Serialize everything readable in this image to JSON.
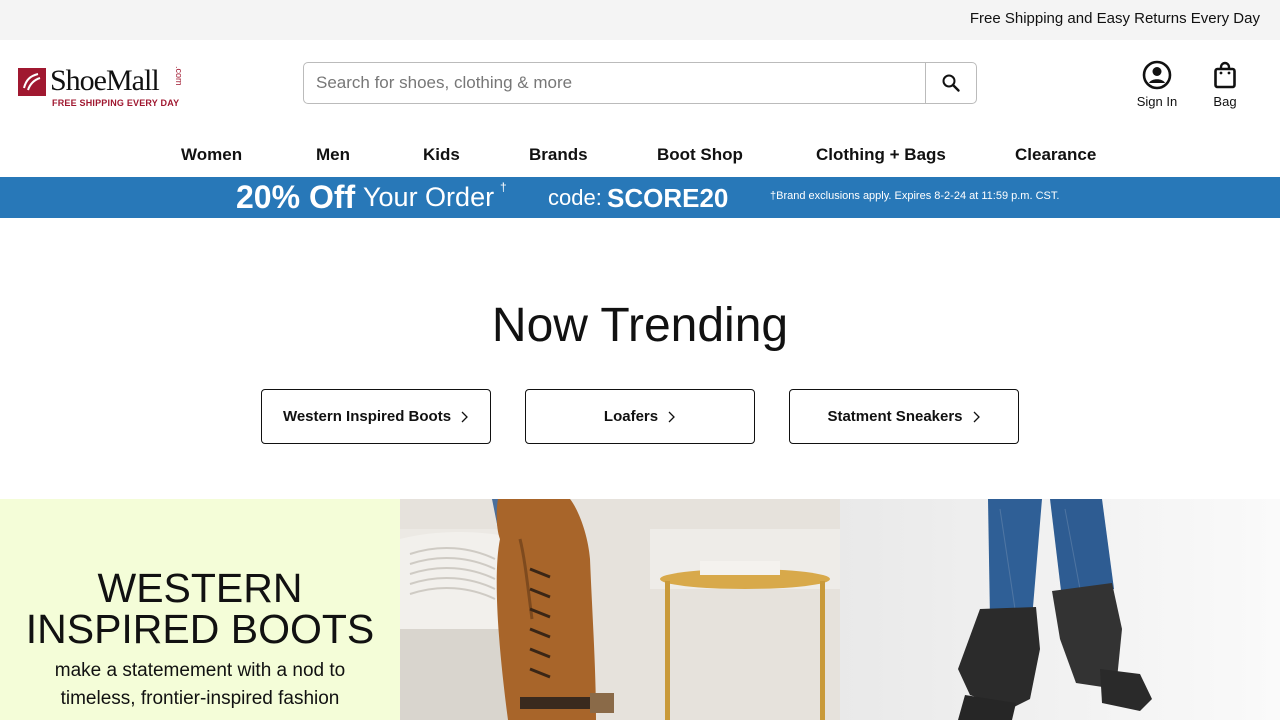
{
  "topbar": {
    "message": "Free Shipping and Easy Returns Every Day"
  },
  "logo": {
    "brand": "ShoeMall",
    "tld": ".com",
    "tagline": "FREE SHIPPING EVERY DAY"
  },
  "search": {
    "placeholder": "Search for shoes, clothing & more",
    "value": ""
  },
  "account": {
    "sign_in": "Sign In",
    "bag": "Bag"
  },
  "nav": {
    "items": [
      {
        "label": "Women"
      },
      {
        "label": "Men"
      },
      {
        "label": "Kids"
      },
      {
        "label": "Brands"
      },
      {
        "label": "Boot Shop"
      },
      {
        "label": "Clothing + Bags"
      },
      {
        "label": "Clearance"
      }
    ]
  },
  "promo": {
    "headline": "20% Off",
    "subhead": "Your Order",
    "dagger": "†",
    "code_label": "code:",
    "code": "SCORE20",
    "disclaimer": "†Brand exclusions apply. Expires 8-2-24 at 11:59 p.m. CST."
  },
  "trending": {
    "title": "Now Trending",
    "pills": [
      {
        "label": "Western Inspired Boots"
      },
      {
        "label": "Loafers"
      },
      {
        "label": "Statment Sneakers"
      }
    ]
  },
  "hero": {
    "title": "WESTERN INSPIRED BOOTS",
    "subtitle": "make a statemement with a nod to timeless, frontier-inspired fashion"
  },
  "colors": {
    "brand": "#a01830",
    "promo_bg": "#2878b8",
    "hero_bg": "#f4fdd8"
  }
}
